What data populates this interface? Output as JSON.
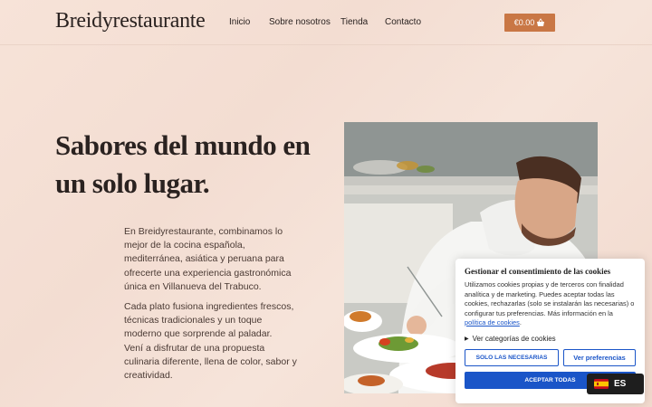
{
  "header": {
    "logo": "Breidyrestaurante",
    "nav": [
      "Inicio",
      "Sobre nosotros",
      "Tienda",
      "Contacto"
    ],
    "cart_label": "€0.00"
  },
  "hero": {
    "title_line1": "Sabores del mundo en",
    "title_line2": "un solo lugar.",
    "paragraph1": "En Breidyrestaurante, combinamos lo mejor de la cocina española, mediterránea, asiática y peruana para ofrecerte una experiencia gastronómica única en Villanueva del Trabuco.",
    "paragraph2": "Cada plato fusiona ingredientes frescos, técnicas tradicionales y un toque moderno que sorprende al paladar.",
    "paragraph3": "Vení a disfrutar de una propuesta culinaria diferente, llena de color, sabor y creatividad."
  },
  "cookie": {
    "title": "Gestionar el consentimiento de las cookies",
    "text": "Utilizamos cookies propias y de terceros con finalidad analítica y de marketing. Puedes aceptar todas las cookies, rechazarlas (solo se instalarán las necesarias) o configurar tus preferencias. Más información en la",
    "link": "política de cookies",
    "text_end": ".",
    "categories": "Ver categorías de cookies",
    "btn_necessary": "SOLO LAS NECESARIAS",
    "btn_prefs": "Ver preferencias",
    "btn_accept": "ACEPTAR TODAS"
  },
  "lang": {
    "code": "ES"
  },
  "colors": {
    "accent": "#c97745",
    "cookie_blue": "#1a55c8"
  }
}
